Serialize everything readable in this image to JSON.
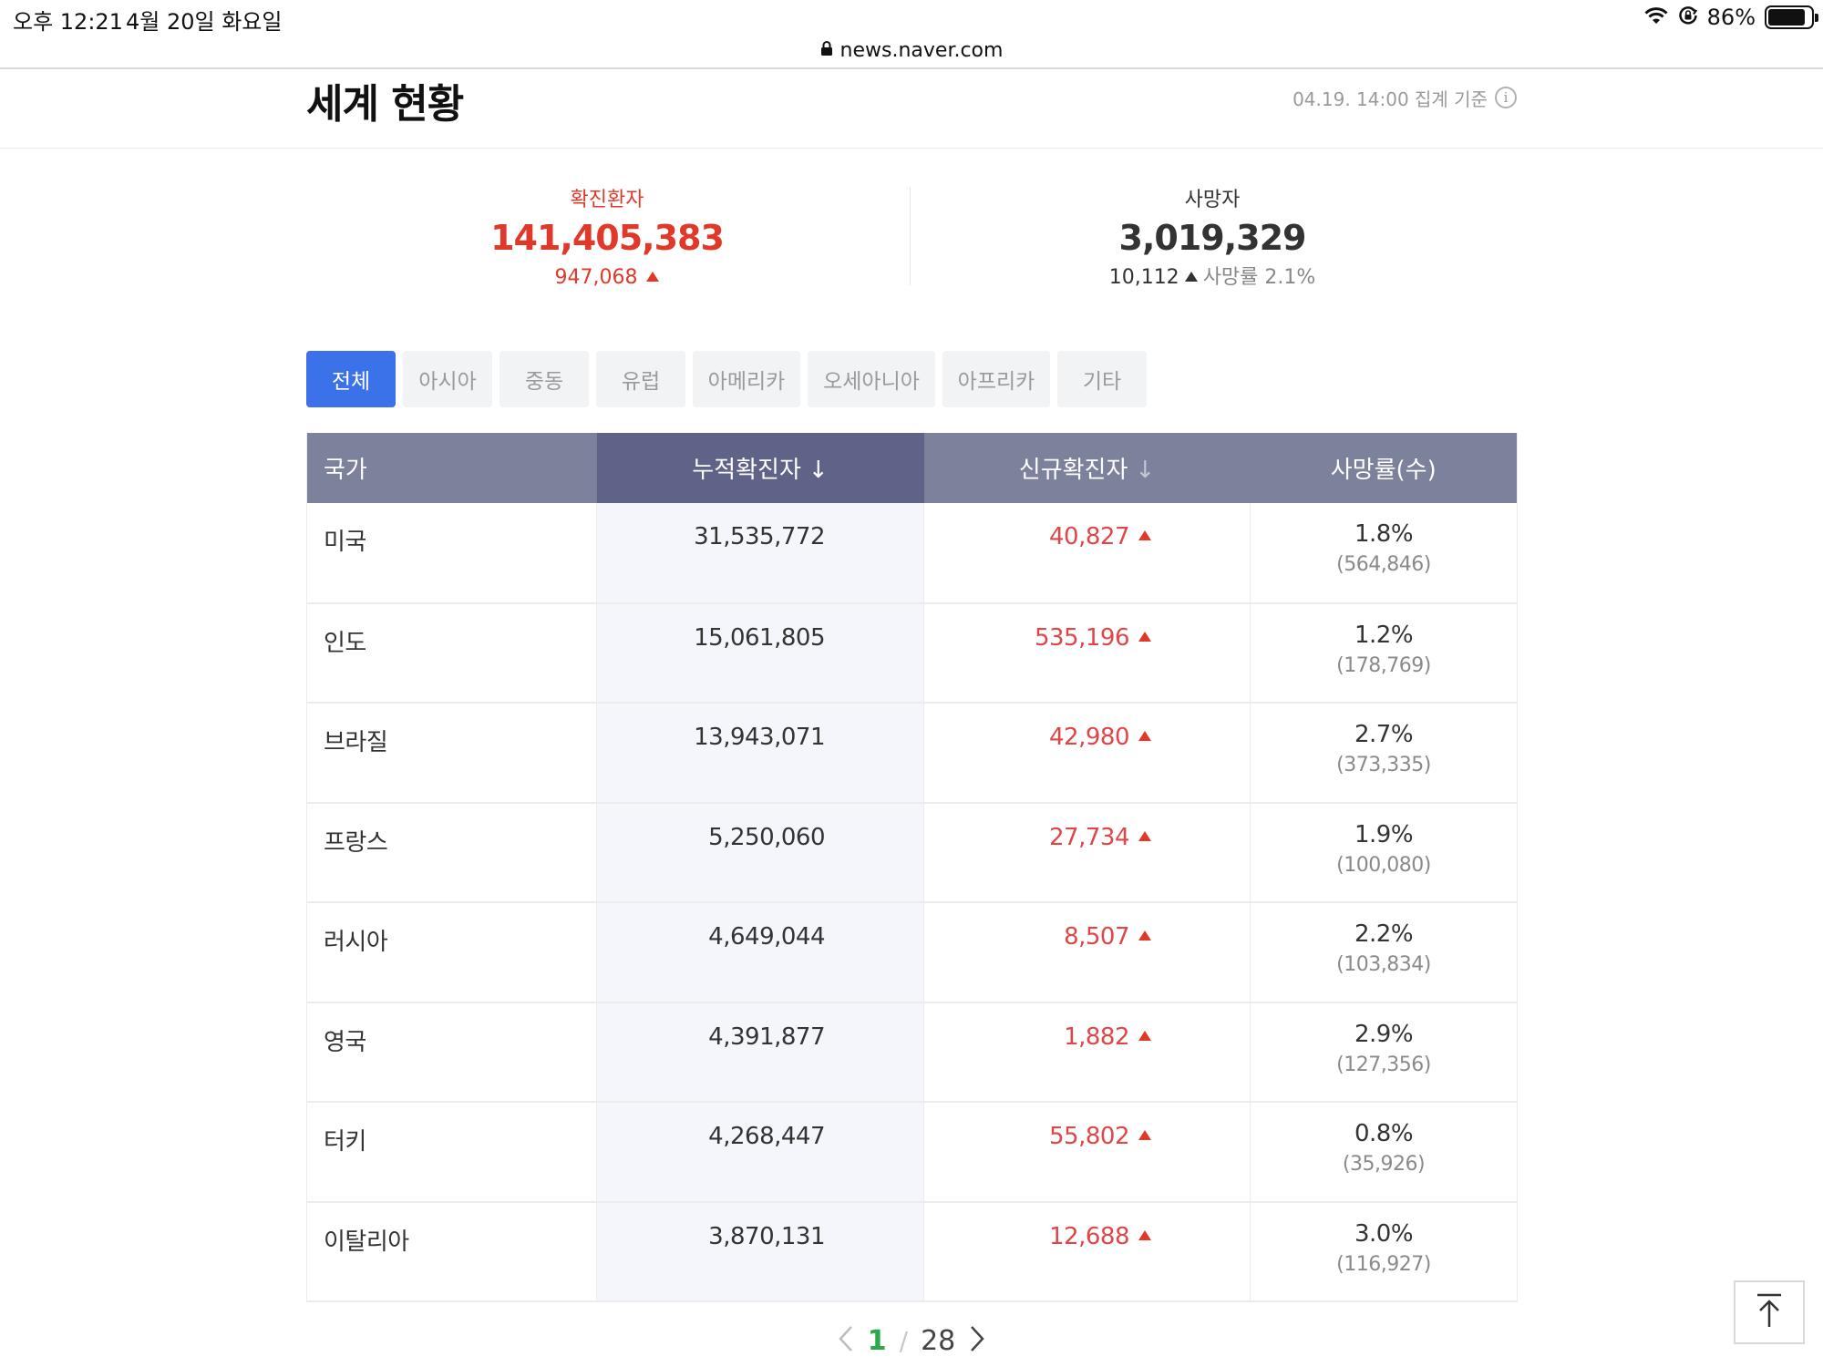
{
  "status_bar": {
    "time": "오후 12:21",
    "date": "4월 20일 화요일",
    "battery_percent": "86%",
    "battery_level": 0.86
  },
  "url_bar": {
    "url": "news.naver.com"
  },
  "header": {
    "title": "세계 현황",
    "aggregation_basis": "04.19. 14:00 집계 기준",
    "info_glyph": "i"
  },
  "summary": {
    "confirmed": {
      "label": "확진환자",
      "value": "141,405,383",
      "delta": "947,068"
    },
    "deaths": {
      "label": "사망자",
      "value": "3,019,329",
      "delta": "10,112",
      "rate_text": "사망률 2.1%"
    }
  },
  "tabs": [
    {
      "label": "전체",
      "active": true
    },
    {
      "label": "아시아",
      "active": false
    },
    {
      "label": "중동",
      "active": false
    },
    {
      "label": "유럽",
      "active": false
    },
    {
      "label": "아메리카",
      "active": false
    },
    {
      "label": "오세아니아",
      "active": false
    },
    {
      "label": "아프리카",
      "active": false
    },
    {
      "label": "기타",
      "active": false
    }
  ],
  "table": {
    "headers": {
      "country": "국가",
      "total": "누적확진자",
      "new": "신규확진자",
      "rate": "사망률(수)",
      "sort_arrow": "↓"
    },
    "rows": [
      {
        "country": "미국",
        "total": "31,535,772",
        "new": "40,827",
        "rate": "1.8%",
        "deaths": "(564,846)"
      },
      {
        "country": "인도",
        "total": "15,061,805",
        "new": "535,196",
        "rate": "1.2%",
        "deaths": "(178,769)"
      },
      {
        "country": "브라질",
        "total": "13,943,071",
        "new": "42,980",
        "rate": "2.7%",
        "deaths": "(373,335)"
      },
      {
        "country": "프랑스",
        "total": "5,250,060",
        "new": "27,734",
        "rate": "1.9%",
        "deaths": "(100,080)"
      },
      {
        "country": "러시아",
        "total": "4,649,044",
        "new": "8,507",
        "rate": "2.2%",
        "deaths": "(103,834)"
      },
      {
        "country": "영국",
        "total": "4,391,877",
        "new": "1,882",
        "rate": "2.9%",
        "deaths": "(127,356)"
      },
      {
        "country": "터키",
        "total": "4,268,447",
        "new": "55,802",
        "rate": "0.8%",
        "deaths": "(35,926)"
      },
      {
        "country": "이탈리아",
        "total": "3,870,131",
        "new": "12,688",
        "rate": "3.0%",
        "deaths": "(116,927)"
      }
    ]
  },
  "pagination": {
    "current": "1",
    "separator": "/",
    "total": "28"
  },
  "icons": {
    "wifi": "wifi-icon",
    "orientation_lock": "orientation-lock-icon",
    "battery": "battery-icon",
    "lock": "lock-icon",
    "info": "info-icon",
    "sort": "arrow-down-icon",
    "increase": "triangle-up-icon",
    "prev": "chevron-left-icon",
    "next": "chevron-right-icon",
    "scroll_top": "scroll-top-icon"
  },
  "colors": {
    "accent_blue": "#3b72ea",
    "increase_red": "#e0392a",
    "header_grey": "#7c819c",
    "header_sorted": "#5f6388",
    "page_green": "#2aa84a"
  }
}
